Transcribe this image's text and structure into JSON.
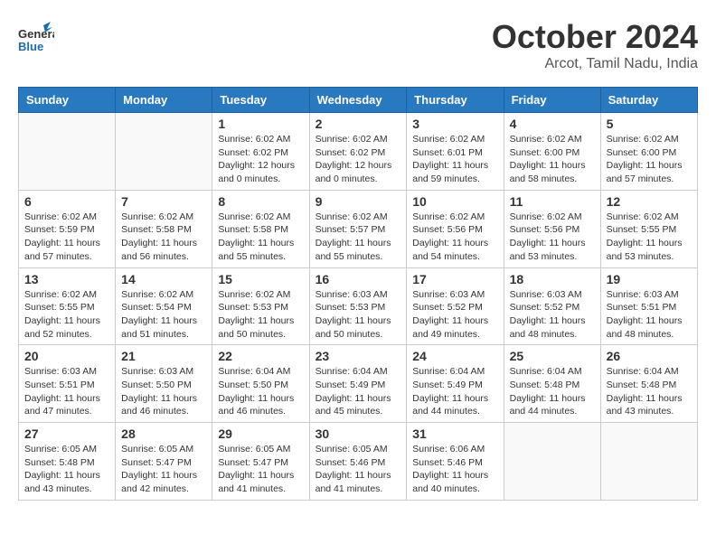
{
  "logo": {
    "general": "General",
    "blue": "Blue"
  },
  "title": "October 2024",
  "subtitle": "Arcot, Tamil Nadu, India",
  "days_header": [
    "Sunday",
    "Monday",
    "Tuesday",
    "Wednesday",
    "Thursday",
    "Friday",
    "Saturday"
  ],
  "weeks": [
    [
      {
        "day": "",
        "info": ""
      },
      {
        "day": "",
        "info": ""
      },
      {
        "day": "1",
        "info": "Sunrise: 6:02 AM\nSunset: 6:02 PM\nDaylight: 12 hours\nand 0 minutes."
      },
      {
        "day": "2",
        "info": "Sunrise: 6:02 AM\nSunset: 6:02 PM\nDaylight: 12 hours\nand 0 minutes."
      },
      {
        "day": "3",
        "info": "Sunrise: 6:02 AM\nSunset: 6:01 PM\nDaylight: 11 hours\nand 59 minutes."
      },
      {
        "day": "4",
        "info": "Sunrise: 6:02 AM\nSunset: 6:00 PM\nDaylight: 11 hours\nand 58 minutes."
      },
      {
        "day": "5",
        "info": "Sunrise: 6:02 AM\nSunset: 6:00 PM\nDaylight: 11 hours\nand 57 minutes."
      }
    ],
    [
      {
        "day": "6",
        "info": "Sunrise: 6:02 AM\nSunset: 5:59 PM\nDaylight: 11 hours\nand 57 minutes."
      },
      {
        "day": "7",
        "info": "Sunrise: 6:02 AM\nSunset: 5:58 PM\nDaylight: 11 hours\nand 56 minutes."
      },
      {
        "day": "8",
        "info": "Sunrise: 6:02 AM\nSunset: 5:58 PM\nDaylight: 11 hours\nand 55 minutes."
      },
      {
        "day": "9",
        "info": "Sunrise: 6:02 AM\nSunset: 5:57 PM\nDaylight: 11 hours\nand 55 minutes."
      },
      {
        "day": "10",
        "info": "Sunrise: 6:02 AM\nSunset: 5:56 PM\nDaylight: 11 hours\nand 54 minutes."
      },
      {
        "day": "11",
        "info": "Sunrise: 6:02 AM\nSunset: 5:56 PM\nDaylight: 11 hours\nand 53 minutes."
      },
      {
        "day": "12",
        "info": "Sunrise: 6:02 AM\nSunset: 5:55 PM\nDaylight: 11 hours\nand 53 minutes."
      }
    ],
    [
      {
        "day": "13",
        "info": "Sunrise: 6:02 AM\nSunset: 5:55 PM\nDaylight: 11 hours\nand 52 minutes."
      },
      {
        "day": "14",
        "info": "Sunrise: 6:02 AM\nSunset: 5:54 PM\nDaylight: 11 hours\nand 51 minutes."
      },
      {
        "day": "15",
        "info": "Sunrise: 6:02 AM\nSunset: 5:53 PM\nDaylight: 11 hours\nand 50 minutes."
      },
      {
        "day": "16",
        "info": "Sunrise: 6:03 AM\nSunset: 5:53 PM\nDaylight: 11 hours\nand 50 minutes."
      },
      {
        "day": "17",
        "info": "Sunrise: 6:03 AM\nSunset: 5:52 PM\nDaylight: 11 hours\nand 49 minutes."
      },
      {
        "day": "18",
        "info": "Sunrise: 6:03 AM\nSunset: 5:52 PM\nDaylight: 11 hours\nand 48 minutes."
      },
      {
        "day": "19",
        "info": "Sunrise: 6:03 AM\nSunset: 5:51 PM\nDaylight: 11 hours\nand 48 minutes."
      }
    ],
    [
      {
        "day": "20",
        "info": "Sunrise: 6:03 AM\nSunset: 5:51 PM\nDaylight: 11 hours\nand 47 minutes."
      },
      {
        "day": "21",
        "info": "Sunrise: 6:03 AM\nSunset: 5:50 PM\nDaylight: 11 hours\nand 46 minutes."
      },
      {
        "day": "22",
        "info": "Sunrise: 6:04 AM\nSunset: 5:50 PM\nDaylight: 11 hours\nand 46 minutes."
      },
      {
        "day": "23",
        "info": "Sunrise: 6:04 AM\nSunset: 5:49 PM\nDaylight: 11 hours\nand 45 minutes."
      },
      {
        "day": "24",
        "info": "Sunrise: 6:04 AM\nSunset: 5:49 PM\nDaylight: 11 hours\nand 44 minutes."
      },
      {
        "day": "25",
        "info": "Sunrise: 6:04 AM\nSunset: 5:48 PM\nDaylight: 11 hours\nand 44 minutes."
      },
      {
        "day": "26",
        "info": "Sunrise: 6:04 AM\nSunset: 5:48 PM\nDaylight: 11 hours\nand 43 minutes."
      }
    ],
    [
      {
        "day": "27",
        "info": "Sunrise: 6:05 AM\nSunset: 5:48 PM\nDaylight: 11 hours\nand 43 minutes."
      },
      {
        "day": "28",
        "info": "Sunrise: 6:05 AM\nSunset: 5:47 PM\nDaylight: 11 hours\nand 42 minutes."
      },
      {
        "day": "29",
        "info": "Sunrise: 6:05 AM\nSunset: 5:47 PM\nDaylight: 11 hours\nand 41 minutes."
      },
      {
        "day": "30",
        "info": "Sunrise: 6:05 AM\nSunset: 5:46 PM\nDaylight: 11 hours\nand 41 minutes."
      },
      {
        "day": "31",
        "info": "Sunrise: 6:06 AM\nSunset: 5:46 PM\nDaylight: 11 hours\nand 40 minutes."
      },
      {
        "day": "",
        "info": ""
      },
      {
        "day": "",
        "info": ""
      }
    ]
  ]
}
